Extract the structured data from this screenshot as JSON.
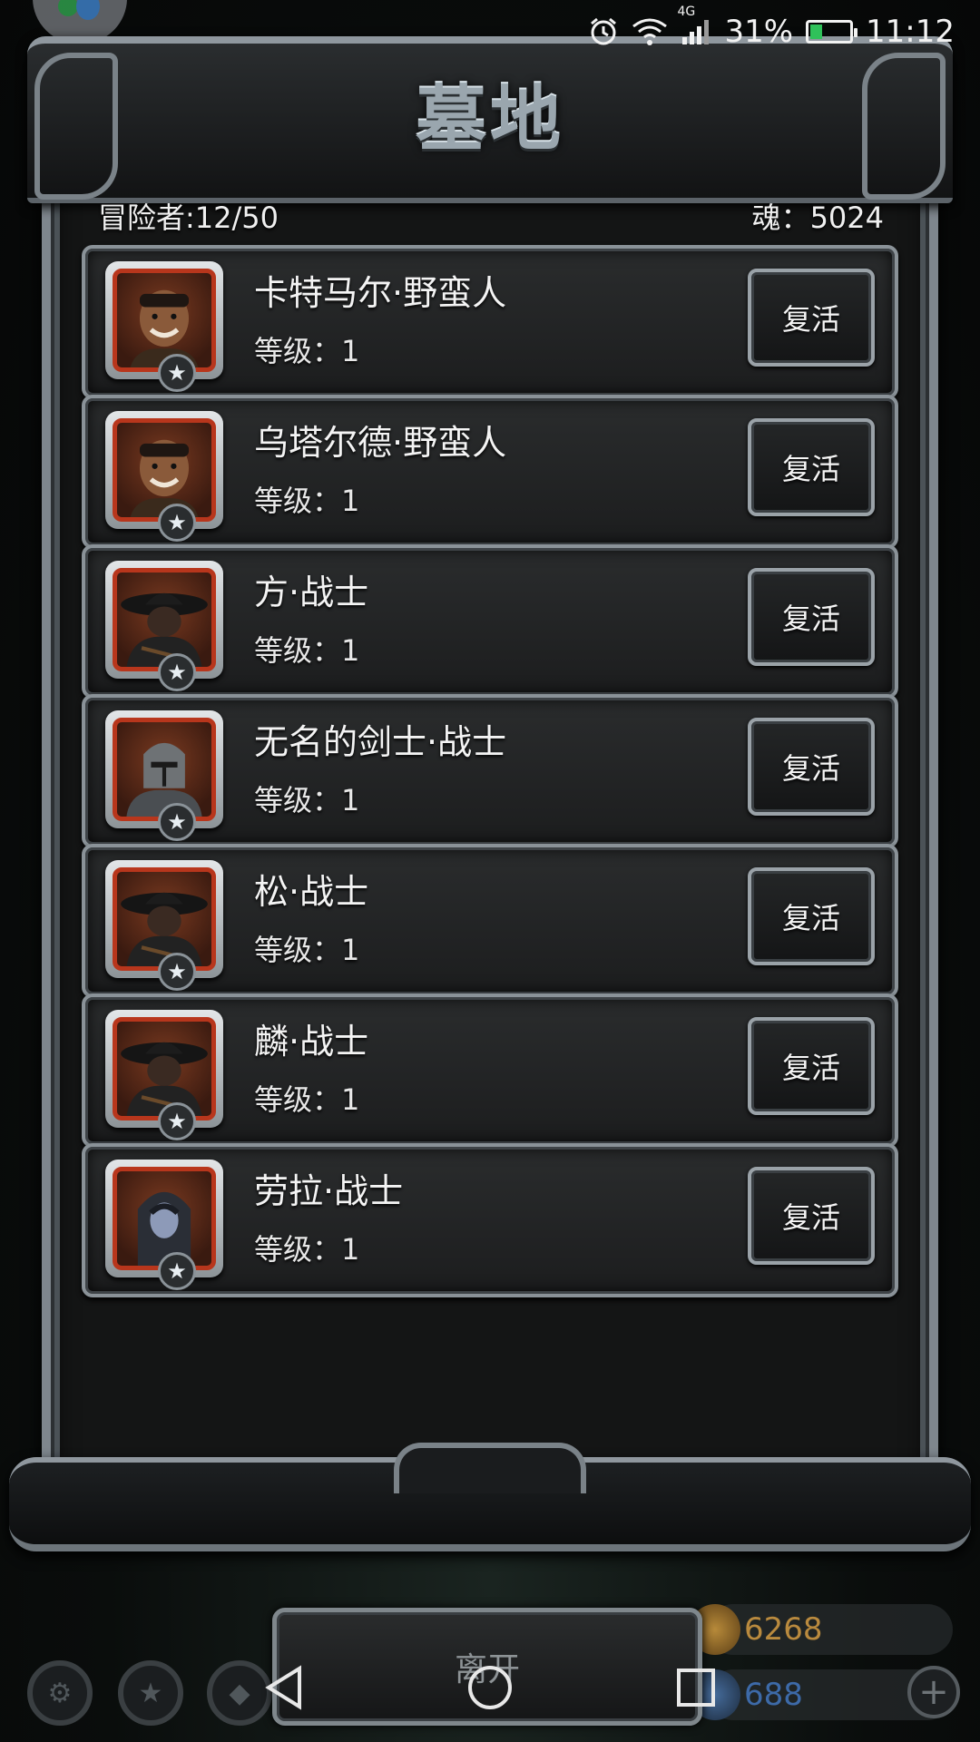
{
  "status_bar": {
    "signal_label": "4G",
    "battery_percent": "31%",
    "battery_level": 0.31,
    "time": "11:12",
    "icons": [
      "alarm-icon",
      "wifi-icon",
      "signal-icon",
      "battery-icon"
    ]
  },
  "screen": {
    "title": "墓地"
  },
  "summary": {
    "adventurers_label": "冒险者:",
    "adventurers_value": "12/50",
    "souls_label": "魂：",
    "souls_value": "5024"
  },
  "heroes": [
    {
      "name": "卡特马尔·野蛮人",
      "level": "等级：1",
      "action": "复活",
      "portrait": "barbarian-portrait",
      "stars": 1
    },
    {
      "name": "乌塔尔德·野蛮人",
      "level": "等级：1",
      "action": "复活",
      "portrait": "barbarian-portrait",
      "stars": 1
    },
    {
      "name": "方·战士",
      "level": "等级：1",
      "action": "复活",
      "portrait": "hat-warrior-portrait",
      "stars": 1
    },
    {
      "name": "无名的剑士·战士",
      "level": "等级：1",
      "action": "复活",
      "portrait": "helmet-knight-portrait",
      "stars": 1
    },
    {
      "name": "松·战士",
      "level": "等级：1",
      "action": "复活",
      "portrait": "hat-warrior-portrait",
      "stars": 1
    },
    {
      "name": "麟·战士",
      "level": "等级：1",
      "action": "复活",
      "portrait": "hat-warrior-portrait",
      "stars": 1
    },
    {
      "name": "劳拉·战士",
      "level": "等级：1",
      "action": "复活",
      "portrait": "hooded-woman-portrait",
      "stars": 1
    }
  ],
  "leave_button": "离开",
  "hud": {
    "gold": "6268",
    "gems": "688",
    "plus": "+"
  },
  "nav": [
    "back-icon",
    "home-icon",
    "recents-icon"
  ],
  "colors": {
    "portrait_border": "#b8361c",
    "frame_metal": "#8a9298",
    "battery_fill": "#2fc15a",
    "gold_text": "#b98a3e",
    "gem_text": "#3d6aa8"
  }
}
